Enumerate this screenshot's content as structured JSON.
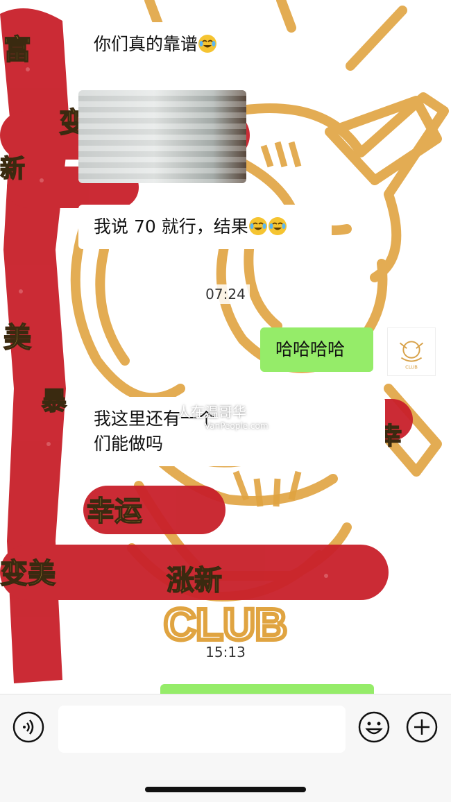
{
  "messages": {
    "m1": "你们真的靠谱",
    "m2": "我说 70 就行，结果",
    "m3": "哈哈哈哈",
    "m4_line1": "我这里还有一个",
    "m4_line2": "们能做吗"
  },
  "timestamps": {
    "t1": "07:24",
    "t2": "15:13"
  },
  "background": {
    "club_text": "CLUB"
  },
  "stickers": [
    "富",
    "变美",
    "新",
    "美",
    "暴",
    "幸运",
    "变美",
    "涨新",
    "幸"
  ],
  "watermark": {
    "main": "人在温哥华",
    "sub": "VanPeople.com"
  },
  "colors": {
    "my_bubble": "#95ec69",
    "other_bubble": "#ffffff",
    "art": "#e0a441",
    "sticker_red": "#c8202a",
    "sticker_gold": "#e8c34a"
  },
  "icons": [
    "voice-icon",
    "emoji-icon",
    "plus-icon",
    "laugh-cry-emoji"
  ]
}
